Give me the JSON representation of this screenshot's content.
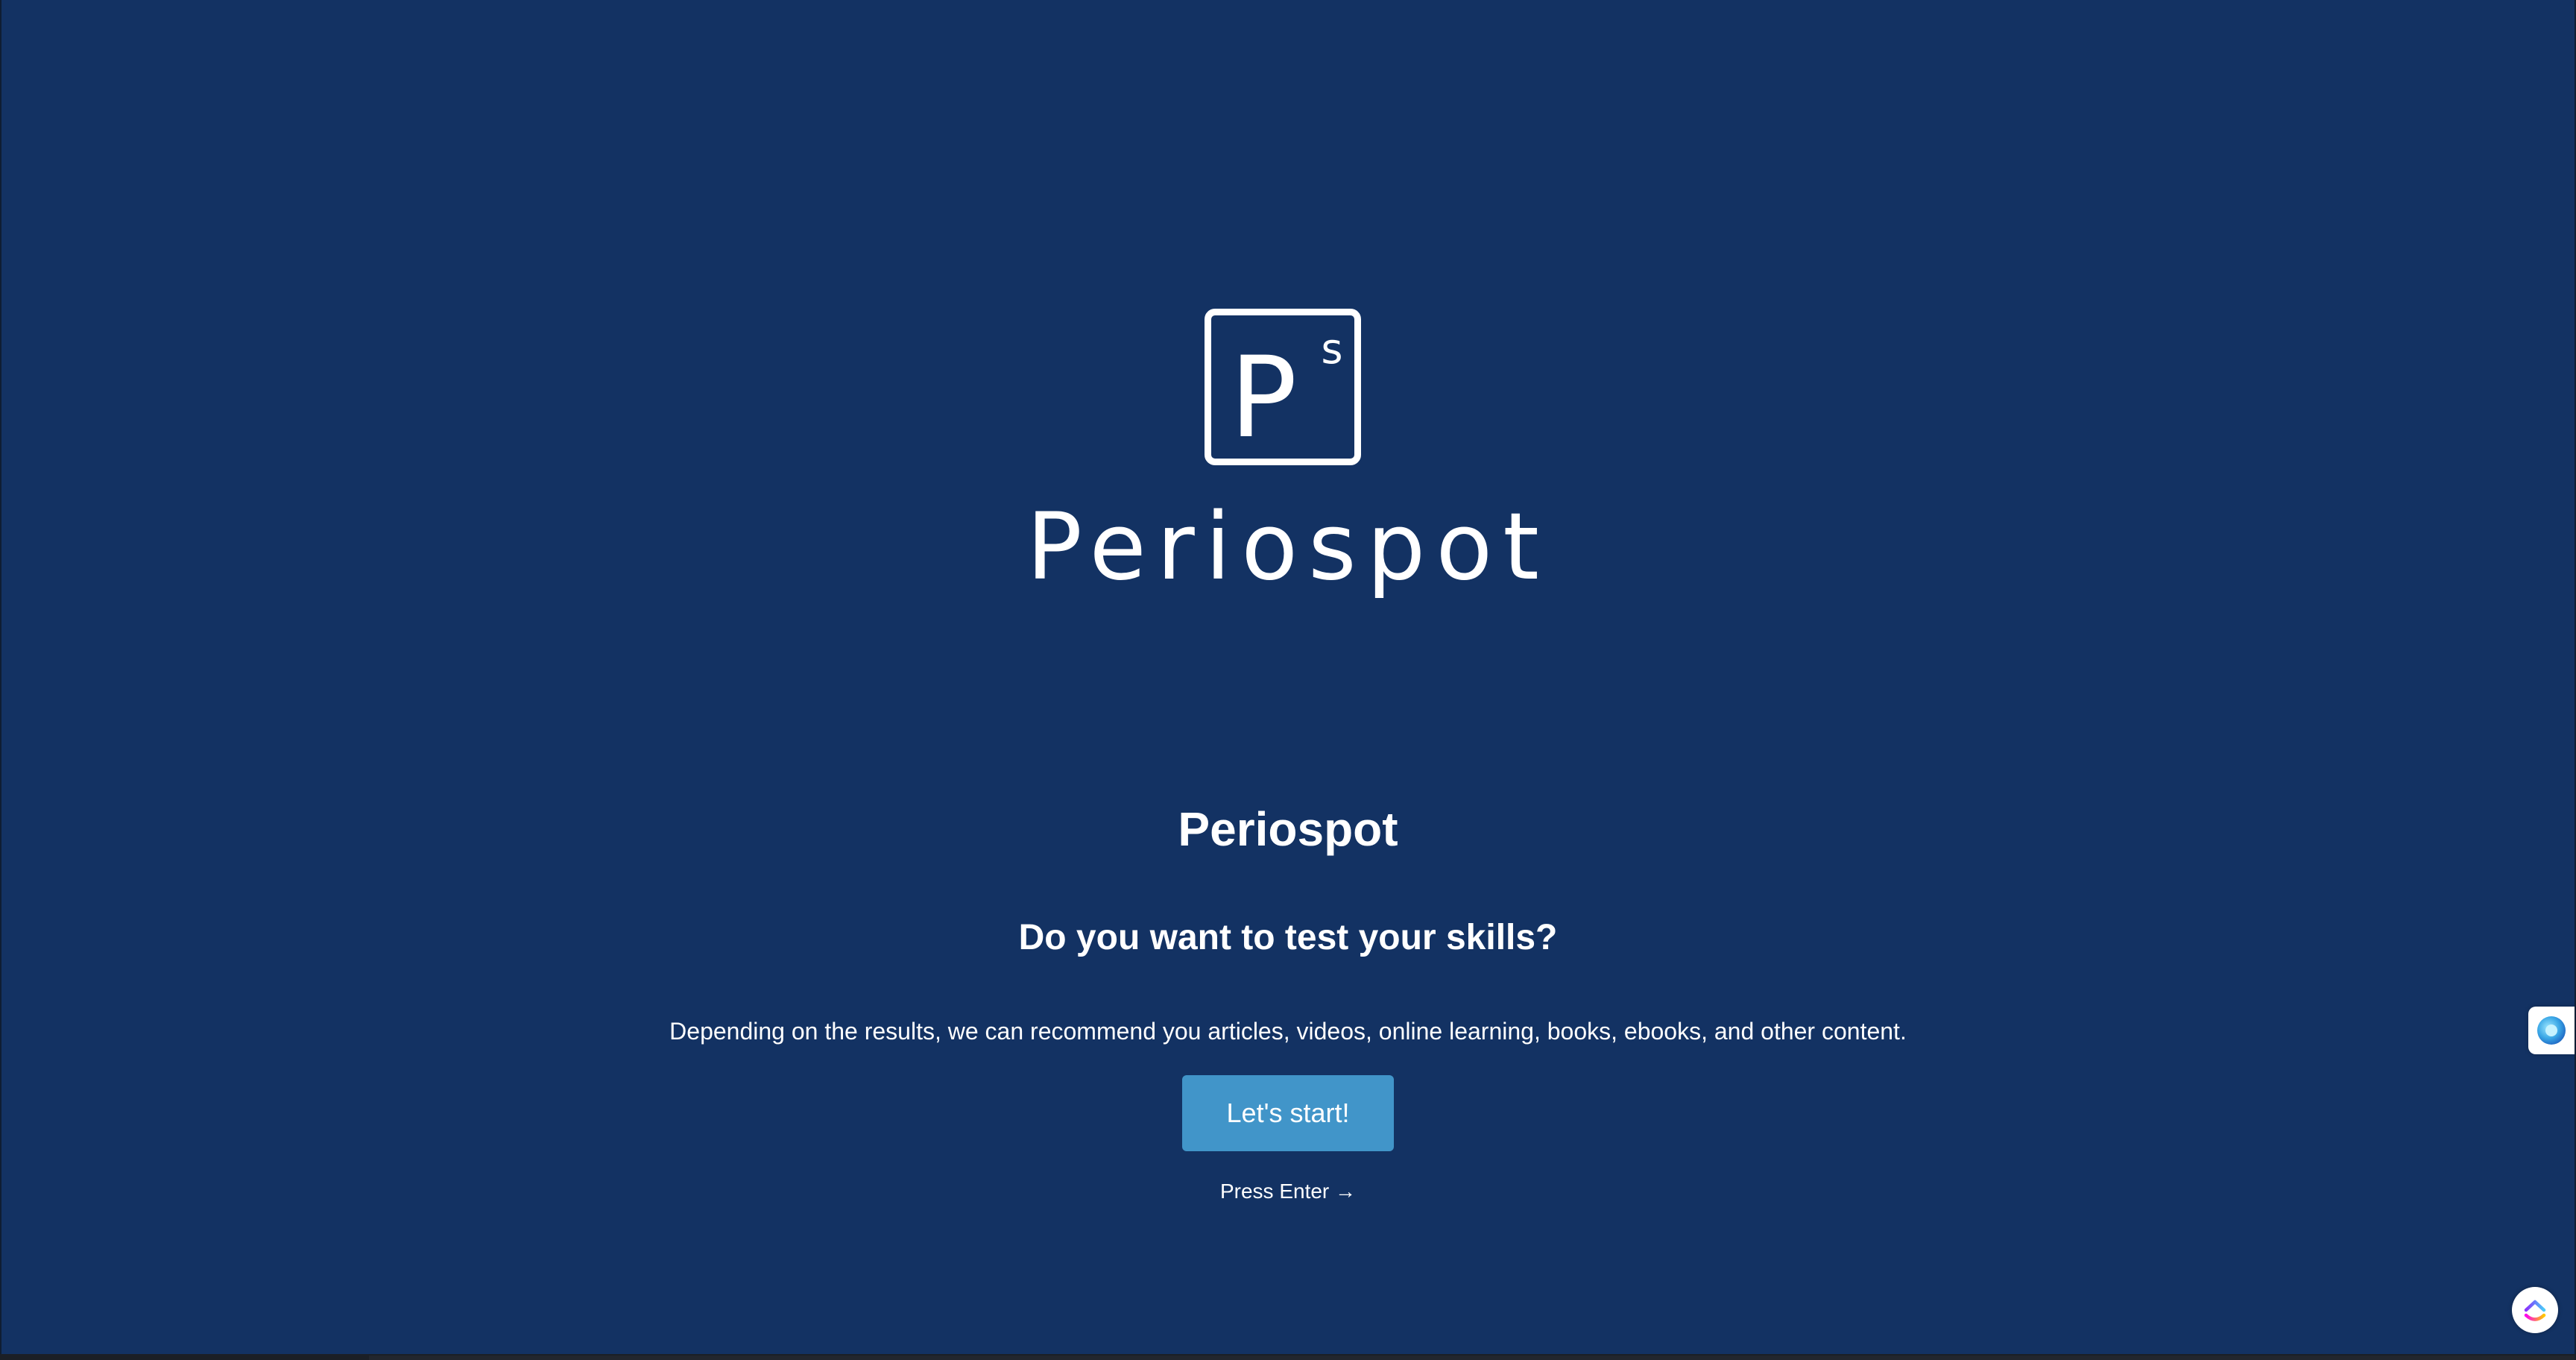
{
  "brand": {
    "logo_letter": "P",
    "logo_superscript": "s",
    "wordmark": "Periospot"
  },
  "intro": {
    "title": "Periospot",
    "subtitle": "Do you want to test your skills?",
    "description": "Depending on the results, we can recommend you articles, videos, online learning, books, ebooks, and other content.",
    "start_label": "Let's start!",
    "press_enter": "Press Enter →"
  },
  "widgets": {
    "side_widget_icon": "assistant-orb-icon",
    "corner_widget_icon": "clickup-icon"
  },
  "colors": {
    "background": "#133263",
    "button": "#4195c9",
    "text": "#ffffff"
  }
}
